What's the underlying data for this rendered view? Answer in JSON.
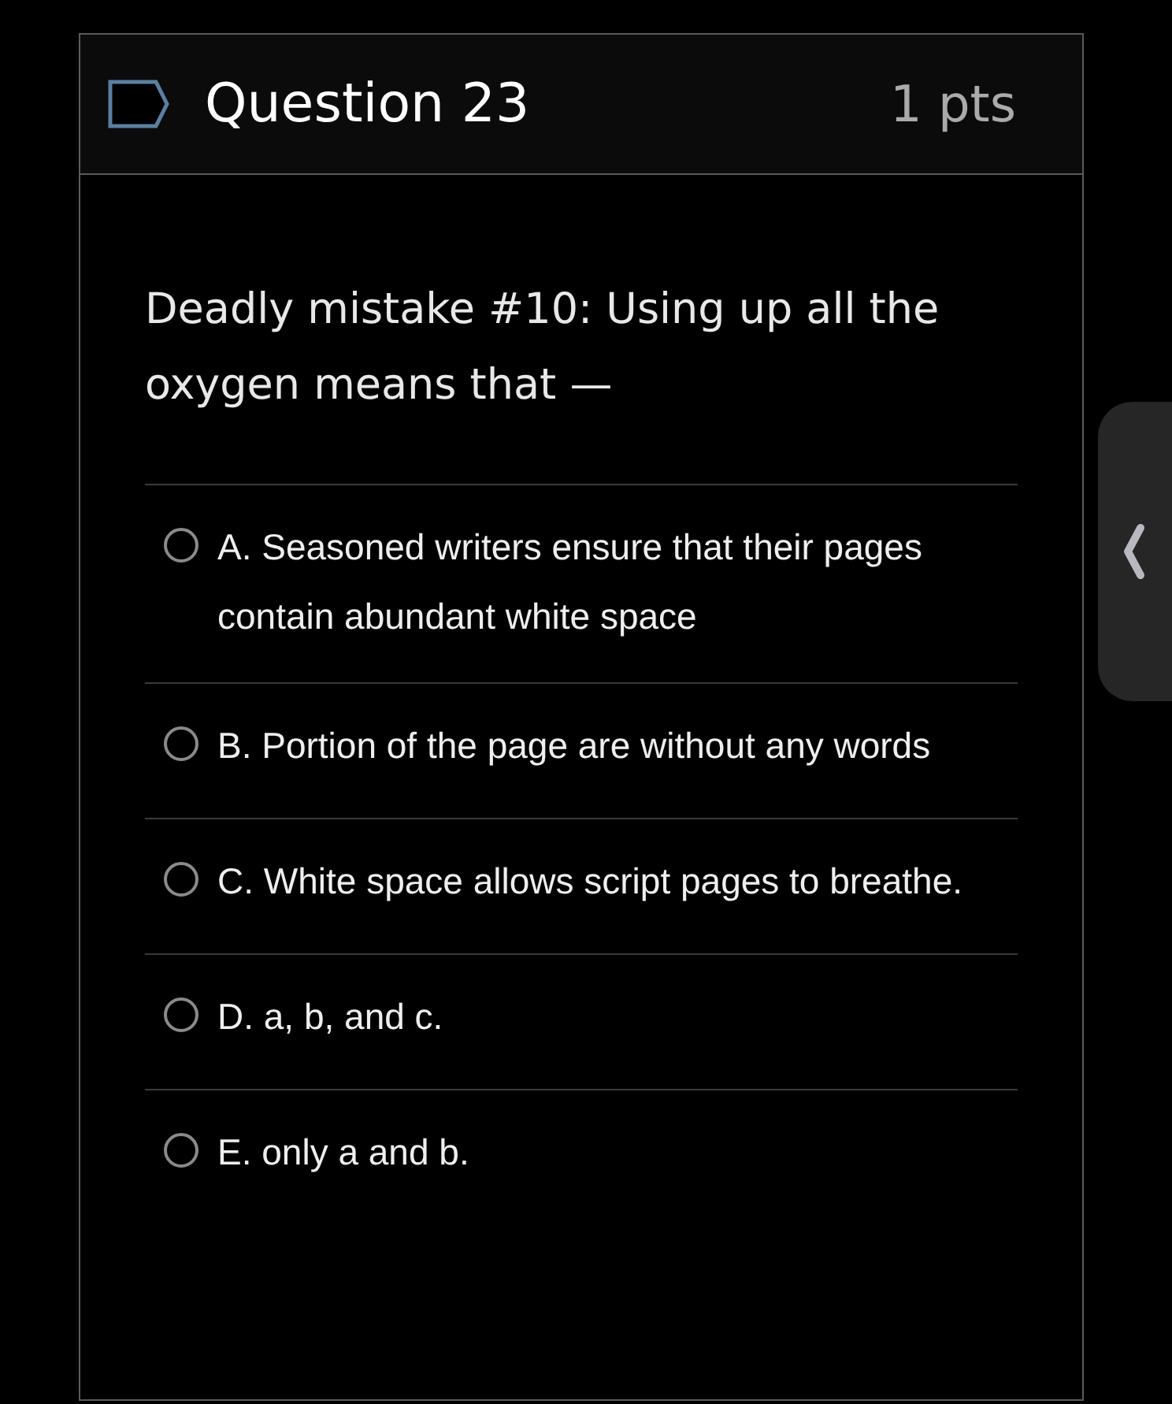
{
  "question": {
    "title": "Question 23",
    "points": "1 pts",
    "text": "Deadly mistake #10: Using up all the oxygen means that —"
  },
  "answers": [
    {
      "label": "A. Seasoned writers ensure that their pages contain abundant white space",
      "selected": false
    },
    {
      "label": "B. Portion of the page are without any words",
      "selected": false
    },
    {
      "label": "C. White space allows script pages to breathe.",
      "selected": false
    },
    {
      "label": "D. a, b, and c.",
      "selected": false
    },
    {
      "label": "E. only a and b.",
      "selected": false
    }
  ]
}
